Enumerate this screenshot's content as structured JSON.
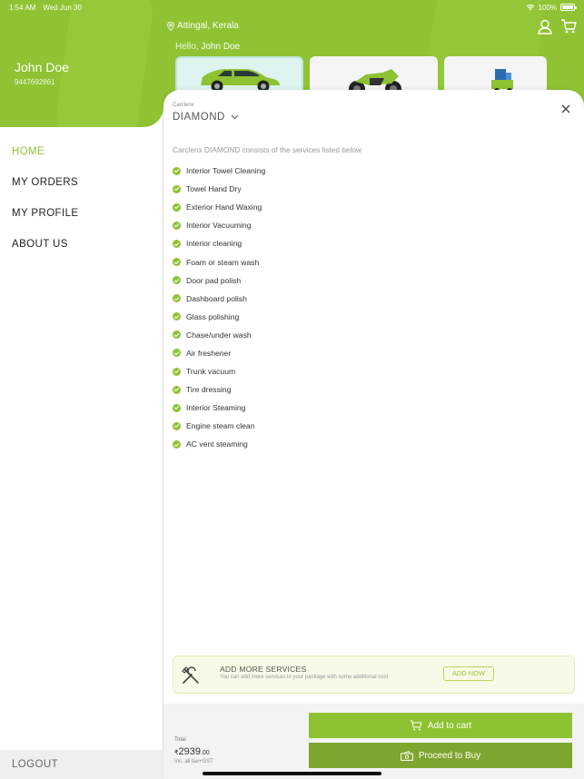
{
  "status_bar": {
    "time": "1:54 AM",
    "date": "Wed Jun 30",
    "battery": "100%"
  },
  "sidebar": {
    "user_name": "John Doe",
    "user_phone": "9447692861",
    "items": [
      {
        "label": "HOME",
        "active": true
      },
      {
        "label": "MY ORDERS",
        "active": false
      },
      {
        "label": "MY PROFILE",
        "active": false
      },
      {
        "label": "ABOUT US",
        "active": false
      }
    ],
    "logout": "LOGOUT"
  },
  "header": {
    "location": "Attingal, Kerala",
    "greeting": "Hello,",
    "greeting_name": "John Doe",
    "vehicles": [
      {
        "name": "car-card",
        "selected": true
      },
      {
        "name": "bike-card",
        "selected": false
      },
      {
        "name": "other-vehicle-card",
        "selected": false
      }
    ]
  },
  "sheet": {
    "brand": "Carclenx",
    "package_name": "DIAMOND",
    "intro": "Carclenx DIAMOND consists of the services listed below",
    "services": [
      "Interior Towel Cleaning",
      "Towel Hand Dry",
      "Exterior Hand Waxing",
      "Interior Vacuuming",
      "Interior cleaning",
      "Foam or steam wash",
      "Door pad polish",
      "Dashboard polish",
      "Glass polishing",
      "Chase/under wash",
      "Air freshener",
      "Trunk vacuum",
      "Tire dressing",
      "Interior Steaming",
      "Engine steam clean",
      "AC vent steaming"
    ],
    "add_more": {
      "title": "ADD MORE SERVICES",
      "subtitle": "You can add more services to your package with some additional cost",
      "button": "ADD NOW"
    },
    "footer": {
      "total_label": "Total",
      "currency": "₹",
      "price": "2939",
      "decimals": ".00",
      "tax_note": "Inc. all tax+GST",
      "add_to_cart": "Add to cart",
      "proceed": "Proceed to Buy"
    }
  },
  "colors": {
    "brand_green": "#8fc333",
    "button_green": "#8dc232",
    "button_dark_green": "#7ea62e"
  }
}
